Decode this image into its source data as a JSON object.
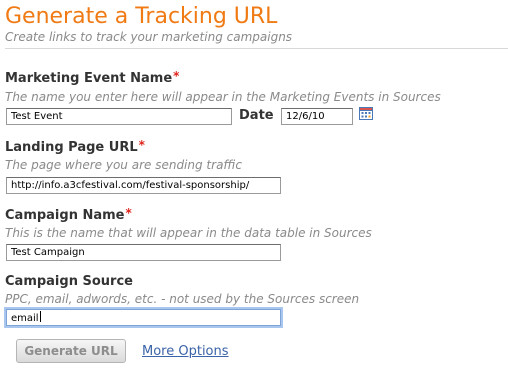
{
  "page": {
    "title": "Generate a Tracking URL",
    "subtitle": "Create links to track your marketing campaigns"
  },
  "fields": {
    "event_name": {
      "label": "Marketing Event Name",
      "required_mark": "*",
      "help": "The name you enter here will appear in the Marketing Events in Sources",
      "value": "Test Event"
    },
    "date": {
      "label": "Date",
      "value": "12/6/10",
      "icon": "calendar-icon"
    },
    "landing_url": {
      "label": "Landing Page URL",
      "required_mark": "*",
      "help": "The page where you are sending traffic",
      "value": "http://info.a3cfestival.com/festival-sponsorship/"
    },
    "campaign_name": {
      "label": "Campaign Name",
      "required_mark": "*",
      "help": "This is the name that will appear in the data table in Sources",
      "value": "Test Campaign"
    },
    "campaign_source": {
      "label": "Campaign Source",
      "help": "PPC, email, adwords, etc. - not used by the Sources screen",
      "value": "email"
    }
  },
  "actions": {
    "generate_label": "Generate URL",
    "more_options_label": "More Options"
  },
  "colors": {
    "title": "#f07a14",
    "required": "#e0241b",
    "link": "#3a63a8",
    "focus_ring": "#a9c6ee"
  }
}
